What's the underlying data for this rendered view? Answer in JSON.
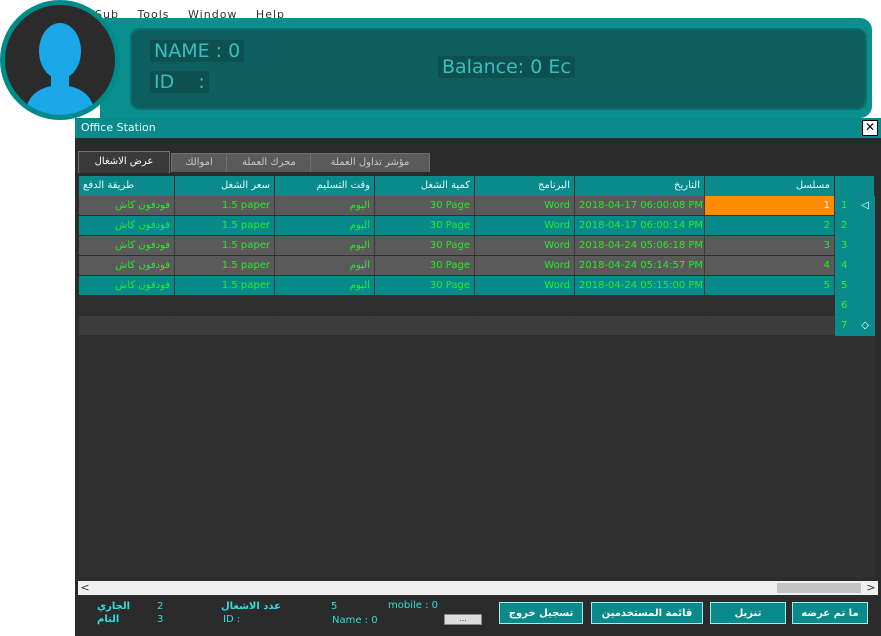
{
  "background_menu": [
    "Sub",
    "Tools",
    "Window",
    "Help"
  ],
  "header": {
    "name_label": "NAME : 0",
    "id_label": "ID    :",
    "balance_label": "Balance:  0 Ec"
  },
  "window": {
    "title": "Office Station",
    "close_symbol": "✕"
  },
  "tabs": [
    "عرض الاشغال",
    "اموالك",
    "محرك العملة",
    "مؤشر تداول العملة"
  ],
  "table": {
    "columns": [
      "مسلسل",
      "التاريخ",
      "البرنامج",
      "كمية الشغل",
      "وقت التسليم",
      "سعر الشغل",
      "طريقة الدفع"
    ],
    "rows": [
      {
        "num": "1",
        "serial": "1",
        "date": "2018-04-17 06:00:08 PM",
        "program": "Word",
        "quantity": "30 Page",
        "delivery": "اليوم",
        "price": "1.5 paper",
        "payment": "فودفون كاش"
      },
      {
        "num": "2",
        "serial": "2",
        "date": "2018-04-17 06:00:14 PM",
        "program": "Word",
        "quantity": "30 Page",
        "delivery": "اليوم",
        "price": "1.5 paper",
        "payment": "فودفون كاش"
      },
      {
        "num": "3",
        "serial": "3",
        "date": "2018-04-24 05:06:18 PM",
        "program": "Word",
        "quantity": "30 Page",
        "delivery": "اليوم",
        "price": "1.5 paper",
        "payment": "فودفون كاش"
      },
      {
        "num": "4",
        "serial": "4",
        "date": "2018-04-24 05:14:57 PM",
        "program": "Word",
        "quantity": "30 Page",
        "delivery": "اليوم",
        "price": "1.5 paper",
        "payment": "فودفون كاش"
      },
      {
        "num": "5",
        "serial": "5",
        "date": "2018-04-24 05:15:00 PM",
        "program": "Word",
        "quantity": "30 Page",
        "delivery": "اليوم",
        "price": "1.5 paper",
        "payment": "فودفون كاش"
      }
    ],
    "extra_row_numbers": [
      "6",
      "7"
    ],
    "selected_row_marker": "◁",
    "new_row_marker": "◇"
  },
  "footer": {
    "current_label": "الجاري",
    "current_value": "2",
    "done_label": "التام",
    "done_value": "3",
    "jobs_count_label": "عدد الاشغال",
    "jobs_count_value": "5",
    "id_text": "ID :",
    "mobile_text": "mobile : 0",
    "name_text": "Name : 0",
    "small_box": "...",
    "buttons": {
      "logout": "تسجيل خروج",
      "users_list": "قائمة المستخدمين",
      "download": "تنزيل",
      "offered": "ما تم عرضه"
    }
  },
  "scroll": {
    "left": "<",
    "right": ">"
  },
  "colors": {
    "teal": "#0a8a8a",
    "dark_panel": "#0d5f5f",
    "row_green_text": "#22ee22",
    "selected": "#ff8c00"
  }
}
